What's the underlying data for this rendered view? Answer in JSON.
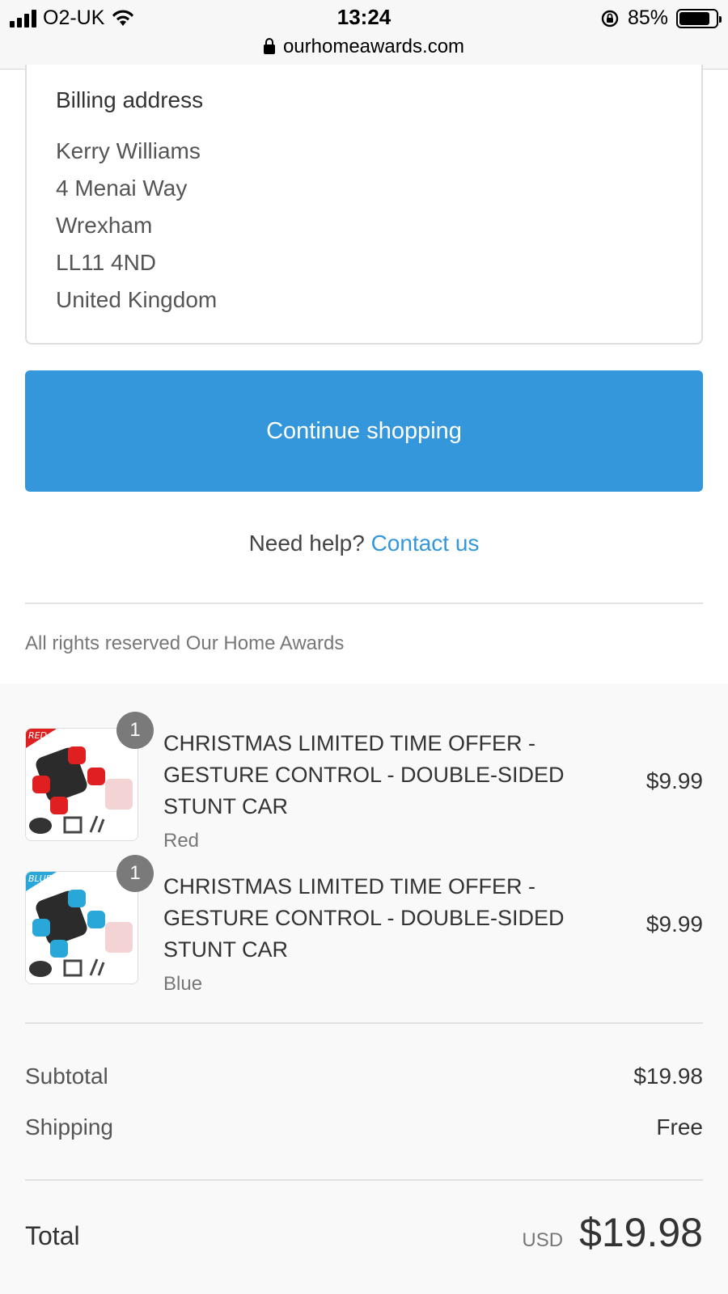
{
  "status_bar": {
    "carrier": "O2-UK",
    "time": "13:24",
    "battery": "85%",
    "battery_level": 0.85,
    "url": "ourhomeawards.com"
  },
  "billing": {
    "title": "Billing address",
    "name": "Kerry Williams",
    "street": "4 Menai Way",
    "city": "Wrexham",
    "postcode": "LL11 4ND",
    "country": "United Kingdom"
  },
  "actions": {
    "continue_label": "Continue shopping",
    "help_prefix": "Need help?",
    "contact_label": "Contact us"
  },
  "footer": {
    "rights": "All rights reserved Our Home Awards"
  },
  "items": [
    {
      "quantity": "1",
      "title": "CHRISTMAS LIMITED TIME OFFER - GESTURE CONTROL - DOUBLE-SIDED STUNT CAR",
      "variant": "Red",
      "price": "$9.99",
      "thumb_tag": "RED",
      "accent": "#e02020"
    },
    {
      "quantity": "1",
      "title": "CHRISTMAS LIMITED TIME OFFER - GESTURE CONTROL - DOUBLE-SIDED STUNT CAR",
      "variant": "Blue",
      "price": "$9.99",
      "thumb_tag": "BLUE",
      "accent": "#2aa7d9"
    }
  ],
  "totals": {
    "subtotal_label": "Subtotal",
    "subtotal_value": "$19.98",
    "shipping_label": "Shipping",
    "shipping_value": "Free",
    "total_label": "Total",
    "currency": "USD",
    "total_value": "$19.98"
  },
  "colors": {
    "primary": "#3497db",
    "badge": "#7a7a7a"
  }
}
